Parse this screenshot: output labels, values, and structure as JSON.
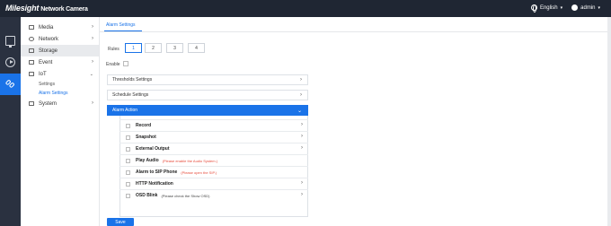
{
  "header": {
    "brand": "Milesight",
    "product": "Network Camera",
    "language": "English",
    "user": "admin"
  },
  "sidebar": {
    "items": [
      {
        "label": "Media"
      },
      {
        "label": "Network"
      },
      {
        "label": "Storage"
      },
      {
        "label": "Event"
      },
      {
        "label": "IoT"
      },
      {
        "label": "System"
      }
    ],
    "sub_items": [
      {
        "label": "Settings"
      },
      {
        "label": "Alarm Settings"
      }
    ]
  },
  "main": {
    "tab": "Alarm Settings",
    "rules_label": "Rules",
    "rules": [
      "1",
      "2",
      "3",
      "4"
    ],
    "enable_label": "Enable",
    "panels": {
      "threshold": "Thresholds Settings",
      "schedule": "Schedule Settings",
      "alarm_action": "Alarm Action"
    },
    "actions": [
      {
        "label": "Record",
        "note": ""
      },
      {
        "label": "Snapshot",
        "note": ""
      },
      {
        "label": "External Output",
        "note": ""
      },
      {
        "label": "Play Audio",
        "note": "(Please enable the Audio System.)"
      },
      {
        "label": "Alarm to SIP Phone",
        "note": "(Please open the SIP.)"
      },
      {
        "label": "HTTP Notification",
        "note": ""
      },
      {
        "label": "OSD Blink",
        "note": "(Please check the Show OSD)"
      }
    ],
    "save_label": "Save"
  }
}
